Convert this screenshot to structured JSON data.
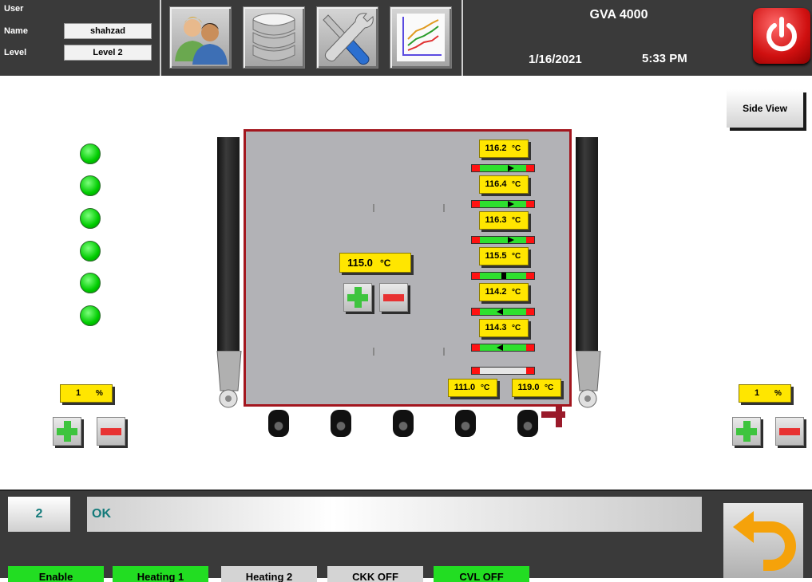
{
  "header": {
    "user_label": "User",
    "name_label": "Name",
    "name_value": "shahzad",
    "level_label": "Level",
    "level_value": "Level 2",
    "title": "GVA 4000",
    "date": "1/16/2021",
    "time": "5:33 PM",
    "nav_icons": [
      "users-icon",
      "database-icon",
      "tools-icon",
      "chart-icon"
    ],
    "power_color": "#d01010"
  },
  "side_view_label": "Side View",
  "setpoint": {
    "value": "115.0",
    "unit": "°C"
  },
  "zones": [
    {
      "value": "116.2",
      "unit": "°C",
      "direction": "right"
    },
    {
      "value": "116.4",
      "unit": "°C",
      "direction": "right"
    },
    {
      "value": "116.3",
      "unit": "°C",
      "direction": "right"
    },
    {
      "value": "115.5",
      "unit": "°C",
      "direction": "center"
    },
    {
      "value": "114.2",
      "unit": "°C",
      "direction": "left"
    },
    {
      "value": "114.3",
      "unit": "°C",
      "direction": "left"
    },
    {
      "value": "",
      "unit": "",
      "direction": "none"
    }
  ],
  "limits": {
    "min": {
      "value": "111.0",
      "unit": "°C"
    },
    "max": {
      "value": "119.0",
      "unit": "°C"
    }
  },
  "left_percent": {
    "value": "1",
    "unit": "%"
  },
  "right_percent": {
    "value": "1",
    "unit": "%"
  },
  "status_leds": [
    "on",
    "on",
    "on",
    "on",
    "on",
    "on"
  ],
  "footer": {
    "code": "2",
    "message": "OK",
    "buttons": [
      "Enable",
      "Heating 1",
      "Heating 2",
      "CKK OFF",
      "CVL OFF"
    ]
  },
  "colors": {
    "accent_yellow": "#ffe600",
    "led_green": "#00cc00",
    "frame_red": "#a3161e",
    "bar_green": "#2ee02e"
  }
}
